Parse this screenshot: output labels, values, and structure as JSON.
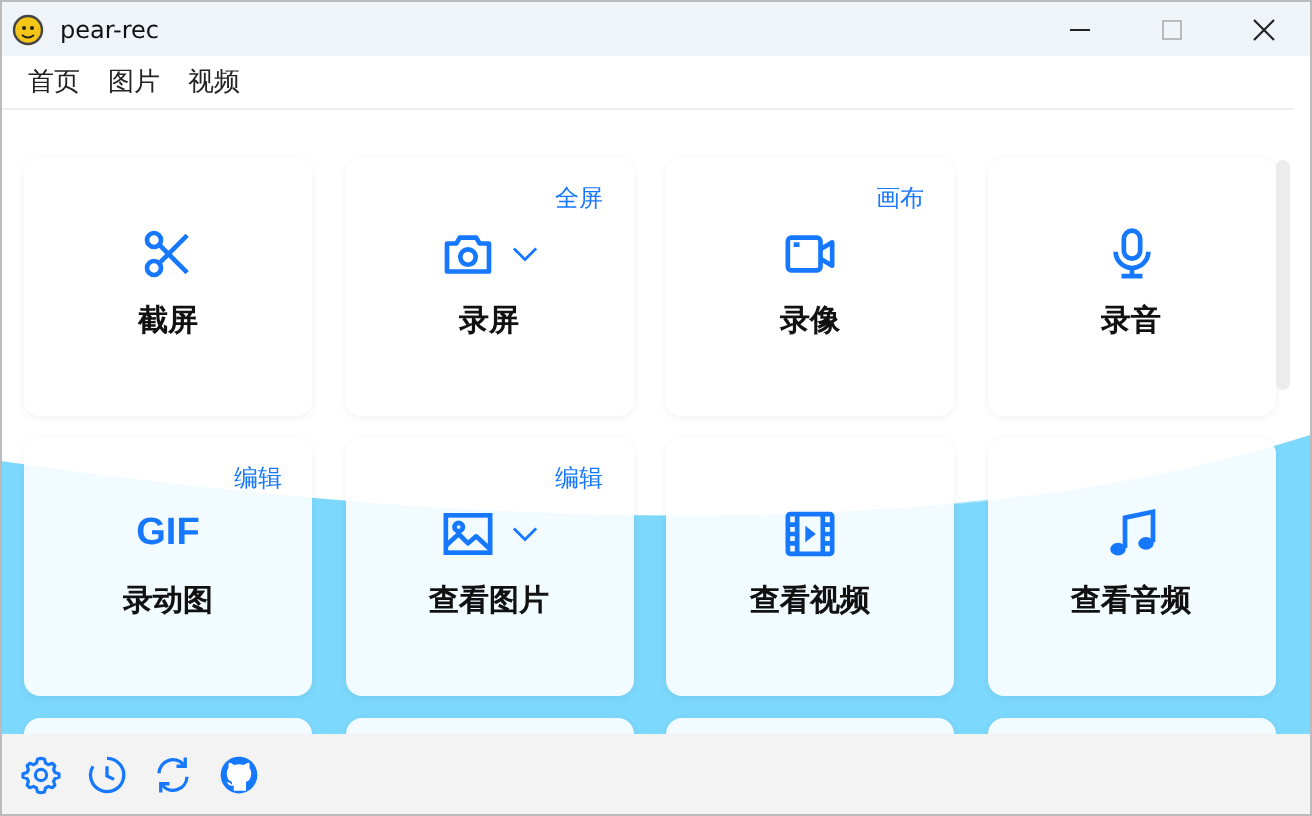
{
  "window": {
    "title": "pear-rec"
  },
  "menu": [
    "首页",
    "图片",
    "视频"
  ],
  "cards": [
    {
      "label": "截屏",
      "kind": "scissors"
    },
    {
      "label": "录屏",
      "kind": "camera",
      "badge": "全屏",
      "dropdown": true
    },
    {
      "label": "录像",
      "kind": "video",
      "badge": "画布"
    },
    {
      "label": "录音",
      "kind": "mic"
    },
    {
      "label": "录动图",
      "kind": "gif",
      "icon_text": "GIF",
      "badge": "编辑"
    },
    {
      "label": "查看图片",
      "kind": "image",
      "badge": "编辑",
      "dropdown": true
    },
    {
      "label": "查看视频",
      "kind": "film"
    },
    {
      "label": "查看音频",
      "kind": "music"
    }
  ]
}
